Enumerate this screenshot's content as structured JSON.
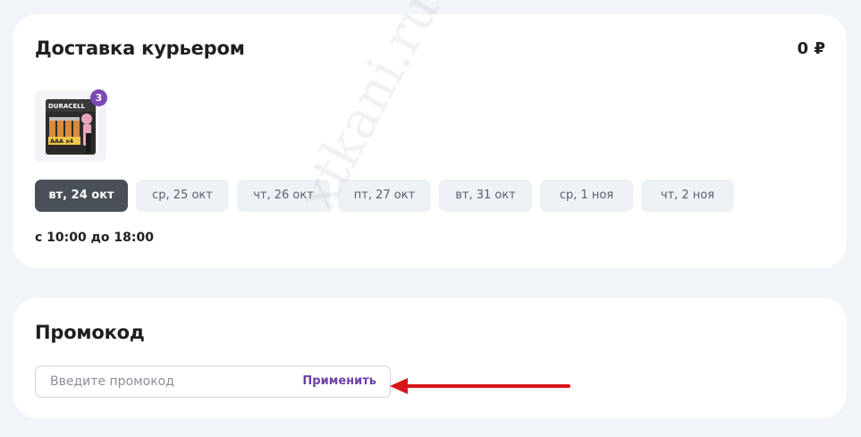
{
  "delivery": {
    "title": "Доставка курьером",
    "price": "0 ₽",
    "product": {
      "brand": "DURACELL",
      "pack_label": "AAA x4",
      "quantity": "3"
    },
    "dates": [
      {
        "label": "вт, 24 окт",
        "selected": true
      },
      {
        "label": "ср, 25 окт",
        "selected": false
      },
      {
        "label": "чт, 26 окт",
        "selected": false
      },
      {
        "label": "пт, 27 окт",
        "selected": false
      },
      {
        "label": "вт, 31 окт",
        "selected": false
      },
      {
        "label": "ср, 1 ноя",
        "selected": false
      },
      {
        "label": "чт, 2 ноя",
        "selected": false
      }
    ],
    "time_range": "с 10:00 до 18:00"
  },
  "promo": {
    "title": "Промокод",
    "placeholder": "Введите промокод",
    "value": "",
    "apply_label": "Применить"
  },
  "watermark": "xtkani.ru",
  "colors": {
    "page_background": "#f1f4f8",
    "card_background": "#ffffff",
    "selected_chip": "#4a5058",
    "chip": "#eef1f6",
    "accent_purple": "#6b3fa6",
    "badge_purple": "#7b48b7",
    "annotation_arrow": "#d9141b"
  }
}
